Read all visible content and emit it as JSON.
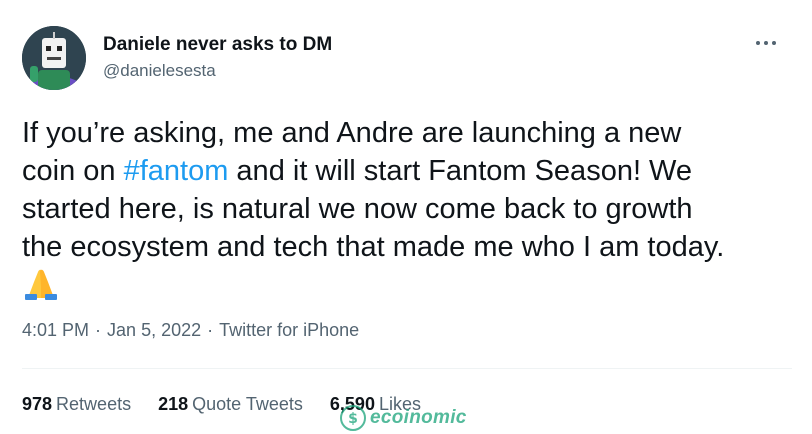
{
  "author": {
    "name": "Daniele never asks to DM",
    "handle": "@danielesesta"
  },
  "tweet": {
    "line1": "If you’re asking, me and Andre are launching a new",
    "line2_pre": "coin on ",
    "hashtag": "#fantom",
    "line2_post": " and it will start Fantom Season! We",
    "line3": "started here, is natural we now come back to growth",
    "line4": "the ecosystem and tech that made me who I am today.",
    "emoji": "folded-hands"
  },
  "meta": {
    "time": "4:01 PM",
    "date": "Jan 5, 2022",
    "source": "Twitter for iPhone",
    "separator": "·"
  },
  "stats": {
    "retweets_count": "978",
    "retweets_label": "Retweets",
    "quotes_count": "218",
    "quotes_label": "Quote Tweets",
    "likes_count": "6,590",
    "likes_label": "Likes"
  },
  "watermark": {
    "text": "ecoinomic"
  },
  "colors": {
    "link": "#1d9bf0",
    "secondary_text": "#536471",
    "primary_text": "#0f1419",
    "watermark": "#1aa37a"
  }
}
